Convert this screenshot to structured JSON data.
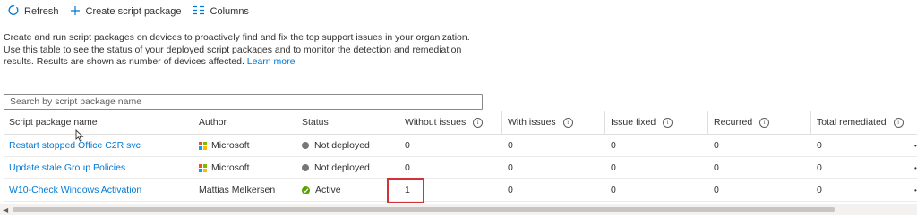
{
  "toolbar": {
    "refresh_label": "Refresh",
    "create_label": "Create script package",
    "columns_label": "Columns"
  },
  "description": {
    "text": "Create and run script packages on devices to proactively find and fix the top support issues in your organization. Use this table to see the status of your deployed script packages and to monitor the detection and remediation results. Results are shown as number of devices affected.",
    "learn_more": "Learn more"
  },
  "search": {
    "placeholder": "Search by script package name",
    "value": ""
  },
  "table": {
    "headers": [
      "Script package name",
      "Author",
      "Status",
      "Without issues",
      "With issues",
      "Issue fixed",
      "Recurred",
      "Total remediated"
    ],
    "rows": [
      {
        "name": "Restart stopped Office C2R svc",
        "author": "Microsoft",
        "status": "Not deployed",
        "without_issues": "0",
        "with_issues": "0",
        "issue_fixed": "0",
        "recurred": "0",
        "total_remediated": "0"
      },
      {
        "name": "Update stale Group Policies",
        "author": "Microsoft",
        "status": "Not deployed",
        "without_issues": "0",
        "with_issues": "0",
        "issue_fixed": "0",
        "recurred": "0",
        "total_remediated": "0"
      },
      {
        "name": "W10-Check Windows Activation",
        "author": "Mattias Melkersen",
        "status": "Active",
        "without_issues": "1",
        "with_issues": "0",
        "issue_fixed": "0",
        "recurred": "0",
        "total_remediated": "0"
      }
    ]
  },
  "colors": {
    "link": "#0078d4",
    "active": "#57a300",
    "not_deployed": "#797775",
    "highlight": "#d13438"
  }
}
